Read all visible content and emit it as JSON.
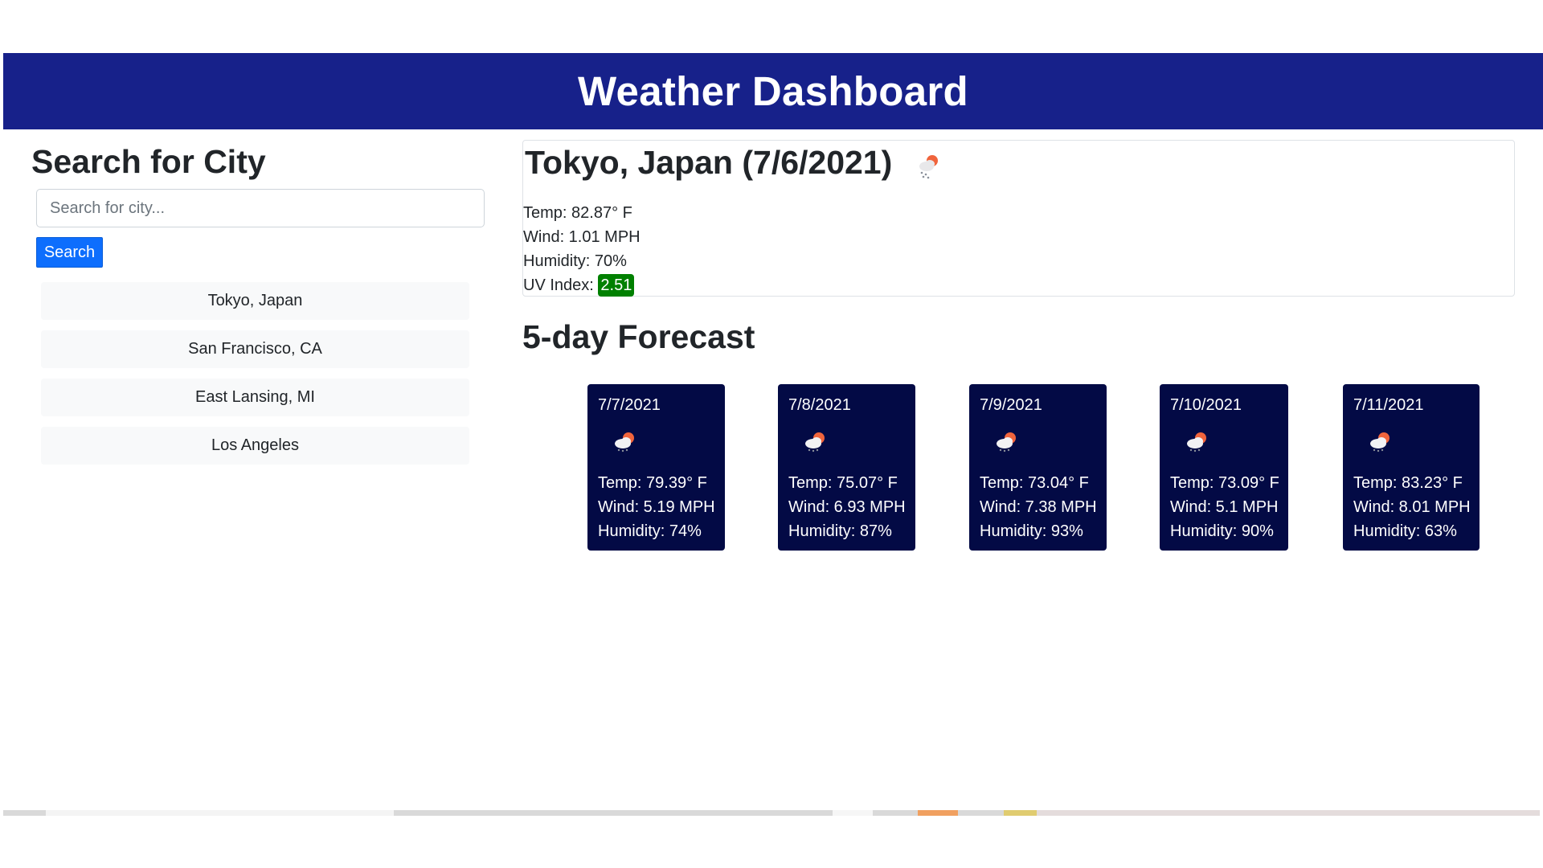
{
  "header": {
    "title": "Weather Dashboard"
  },
  "search": {
    "title": "Search for City",
    "placeholder": "Search for city...",
    "button_label": "Search"
  },
  "history": [
    "Tokyo, Japan",
    "San Francisco, CA",
    "East Lansing, MI",
    "Los Angeles"
  ],
  "current": {
    "title": "Tokyo, Japan (7/6/2021)",
    "icon": "cloud-rain-sun-icon",
    "temp": "Temp: 82.87° F",
    "wind": "Wind: 1.01 MPH",
    "humidity": "Humidity: 70%",
    "uv_label": "UV Index:",
    "uv_value": "2.51",
    "uv_color": "#008000"
  },
  "forecast": {
    "title": "5-day Forecast",
    "days": [
      {
        "date": "7/7/2021",
        "temp": "Temp: 79.39° F",
        "wind": "Wind: 5.19 MPH",
        "humidity": "Humidity: 74%"
      },
      {
        "date": "7/8/2021",
        "temp": "Temp: 75.07° F",
        "wind": "Wind: 6.93 MPH",
        "humidity": "Humidity: 87%"
      },
      {
        "date": "7/9/2021",
        "temp": "Temp: 73.04° F",
        "wind": "Wind: 7.38 MPH",
        "humidity": "Humidity: 93%"
      },
      {
        "date": "7/10/2021",
        "temp": "Temp: 73.09° F",
        "wind": "Wind: 5.1 MPH",
        "humidity": "Humidity: 90%"
      },
      {
        "date": "7/11/2021",
        "temp": "Temp: 83.23° F",
        "wind": "Wind: 8.01 MPH",
        "humidity": "Humidity: 63%"
      }
    ]
  },
  "colors": {
    "header_bg": "#17218a",
    "forecast_card_bg": "#030a45",
    "button_bg": "#0d6efd"
  }
}
